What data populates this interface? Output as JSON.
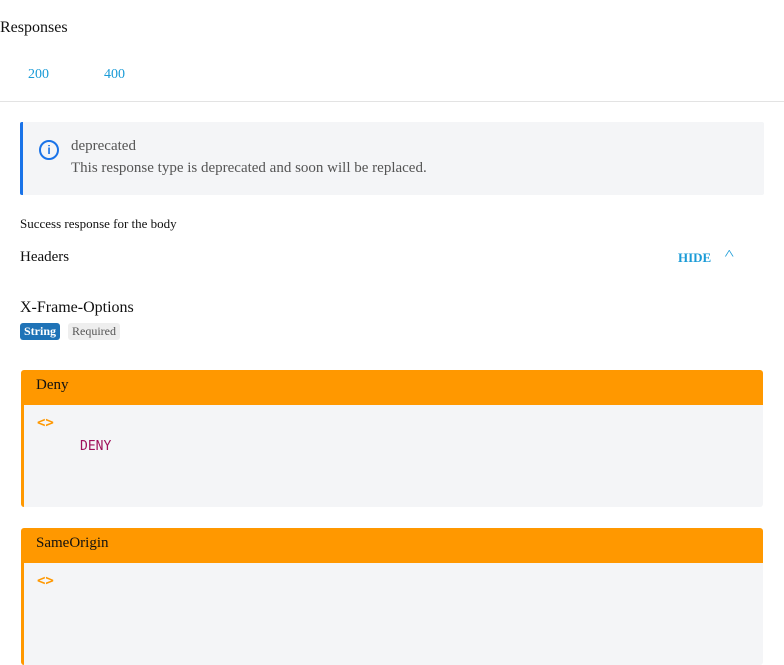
{
  "title": "Responses",
  "tabs": [
    {
      "label": "200"
    },
    {
      "label": "400"
    }
  ],
  "note": {
    "title": "deprecated",
    "text": "This response type is deprecated and soon will be replaced."
  },
  "description": "Success response for the body",
  "headers": {
    "label": "Headers",
    "toggle": "HIDE",
    "name": "X-Frame-Options",
    "type": "String",
    "required": "Required"
  },
  "examples": [
    {
      "title": "Deny",
      "value": "DENY"
    },
    {
      "title": "SameOrigin",
      "value": ""
    }
  ],
  "code_icon": "<>"
}
